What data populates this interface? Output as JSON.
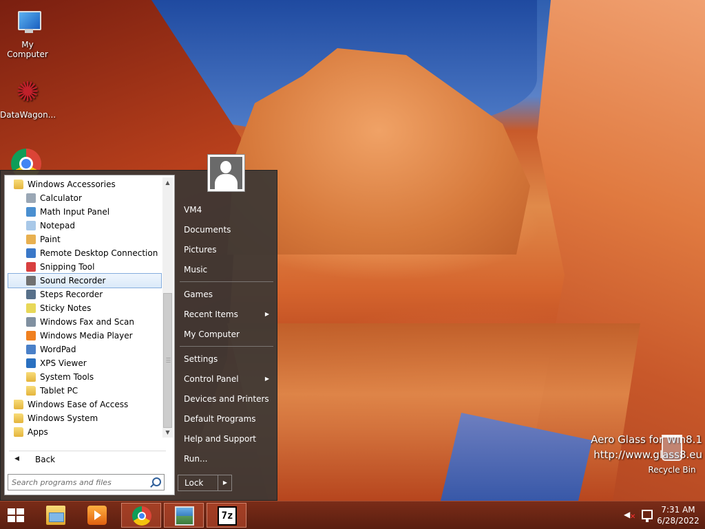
{
  "desktop": {
    "icons": [
      {
        "label": "My Computer",
        "icon": "computer-icon"
      },
      {
        "label": "DataWagon...",
        "icon": "datawagon-icon"
      },
      {
        "label": "",
        "icon": "chrome-icon"
      }
    ],
    "watermark": {
      "line1": "Aero Glass for Win8.1",
      "line2": "http://www.glass8.eu"
    },
    "recycle_bin": {
      "label": "Recycle Bin",
      "icon": "recycle-bin-icon"
    }
  },
  "start_menu": {
    "programs": [
      {
        "label": "Windows Accessories",
        "icon": "folder-icon",
        "level": 0
      },
      {
        "label": "Calculator",
        "icon": "calculator-icon",
        "level": 1
      },
      {
        "label": "Math Input Panel",
        "icon": "math-input-icon",
        "level": 1
      },
      {
        "label": "Notepad",
        "icon": "notepad-icon",
        "level": 1
      },
      {
        "label": "Paint",
        "icon": "paint-icon",
        "level": 1
      },
      {
        "label": "Remote Desktop Connection",
        "icon": "remote-desktop-icon",
        "level": 1
      },
      {
        "label": "Snipping Tool",
        "icon": "snipping-tool-icon",
        "level": 1
      },
      {
        "label": "Sound Recorder",
        "icon": "microphone-icon",
        "level": 1,
        "selected": true
      },
      {
        "label": "Steps Recorder",
        "icon": "steps-recorder-icon",
        "level": 1
      },
      {
        "label": "Sticky Notes",
        "icon": "sticky-notes-icon",
        "level": 1
      },
      {
        "label": "Windows Fax and Scan",
        "icon": "fax-icon",
        "level": 1
      },
      {
        "label": "Windows Media Player",
        "icon": "media-player-icon",
        "level": 1
      },
      {
        "label": "WordPad",
        "icon": "wordpad-icon",
        "level": 1
      },
      {
        "label": "XPS Viewer",
        "icon": "xps-viewer-icon",
        "level": 1
      },
      {
        "label": "System Tools",
        "icon": "folder-icon",
        "level": 1
      },
      {
        "label": "Tablet PC",
        "icon": "folder-icon",
        "level": 1
      },
      {
        "label": "Windows Ease of Access",
        "icon": "folder-icon",
        "level": 0
      },
      {
        "label": "Windows System",
        "icon": "folder-icon",
        "level": 0
      },
      {
        "label": "Apps",
        "icon": "apps-folder-icon",
        "level": 0
      }
    ],
    "back_label": "Back",
    "search_placeholder": "Search programs and files",
    "right_items": [
      {
        "label": "VM4",
        "submenu": false
      },
      {
        "label": "Documents",
        "submenu": false
      },
      {
        "label": "Pictures",
        "submenu": false
      },
      {
        "label": "Music",
        "submenu": false
      },
      {
        "label": "Games",
        "submenu": false
      },
      {
        "label": "Recent Items",
        "submenu": true
      },
      {
        "label": "My Computer",
        "submenu": false
      },
      {
        "label": "Settings",
        "submenu": false
      },
      {
        "label": "Control Panel",
        "submenu": true
      },
      {
        "label": "Devices and Printers",
        "submenu": false
      },
      {
        "label": "Default Programs",
        "submenu": false
      },
      {
        "label": "Help and Support",
        "submenu": false
      },
      {
        "label": "Run...",
        "submenu": false
      }
    ],
    "lock_label": "Lock",
    "user_icon": "user-icon"
  },
  "taskbar": {
    "buttons": [
      {
        "name": "file-explorer",
        "icon": "folder-icon",
        "active": false
      },
      {
        "name": "windows-media-player",
        "icon": "media-player-icon",
        "active": false
      },
      {
        "name": "google-chrome",
        "icon": "chrome-icon",
        "active": true
      },
      {
        "name": "photo-viewer",
        "icon": "photo-icon",
        "active": true
      },
      {
        "name": "7-zip",
        "icon": "7zip-icon",
        "label": "7z",
        "active": true
      }
    ],
    "clock": {
      "time": "7:31 AM",
      "date": "6/28/2022"
    }
  }
}
